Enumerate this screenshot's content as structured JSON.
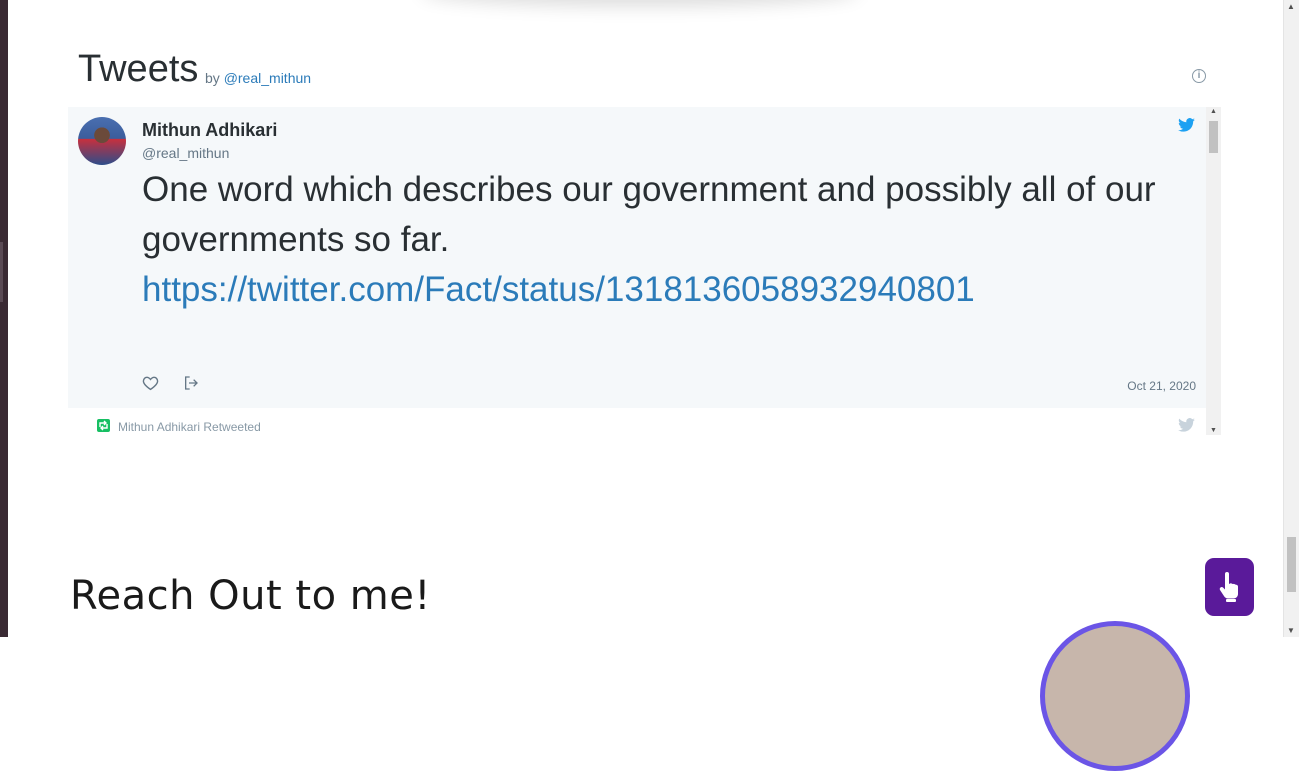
{
  "widget": {
    "title": "Tweets",
    "by_prefix": "by",
    "by_handle": "@real_mithun",
    "info_icon": "info-icon"
  },
  "tweet": {
    "author_name": "Mithun Adhikari",
    "author_handle": "@real_mithun",
    "text": "One word which describes our government and possibly all of our governments so far.",
    "link": "https://twitter.com/Fact/status/1318136058932940801",
    "date": "Oct 21, 2020",
    "icons": [
      "twitter-bird-icon",
      "heart-icon",
      "share-icon"
    ]
  },
  "retweet": {
    "label": "Mithun Adhikari Retweeted",
    "icon": "retweet-icon"
  },
  "section": {
    "heading": "Reach Out to me!"
  },
  "colors": {
    "twitter_blue": "#1da1f2",
    "link_blue": "#2b7bb9",
    "retweet_green": "#17bf63",
    "touch_button_purple": "#5a1a9a",
    "profile_ring": "#6b55e6"
  }
}
